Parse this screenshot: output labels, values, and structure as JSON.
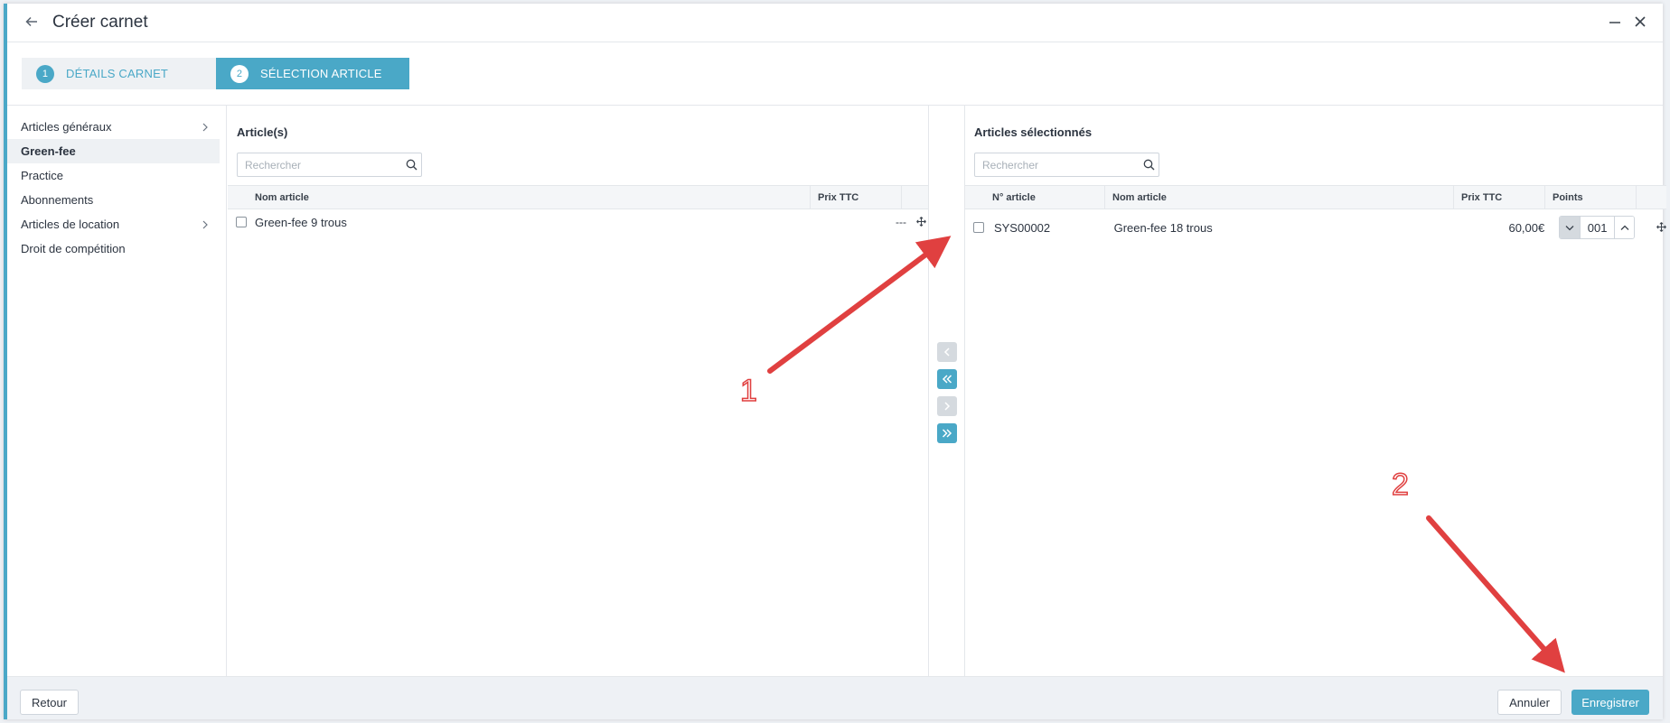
{
  "header": {
    "title": "Créer carnet"
  },
  "steps": [
    {
      "num": "1",
      "label": "DÉTAILS CARNET"
    },
    {
      "num": "2",
      "label": "SÉLECTION ARTICLE"
    }
  ],
  "sidebar": {
    "items": [
      {
        "label": "Articles généraux",
        "has_children": true
      },
      {
        "label": "Green-fee",
        "active": true
      },
      {
        "label": "Practice"
      },
      {
        "label": "Abonnements"
      },
      {
        "label": "Articles de location",
        "has_children": true
      },
      {
        "label": "Droit de compétition"
      }
    ]
  },
  "left_panel": {
    "title": "Article(s)",
    "search_placeholder": "Rechercher",
    "columns": [
      "Nom article",
      "Prix TTC"
    ],
    "rows": [
      {
        "name": "Green-fee 9 trous",
        "price": "---"
      }
    ]
  },
  "right_panel": {
    "title": "Articles sélectionnés",
    "search_placeholder": "Rechercher",
    "columns": [
      "N° article",
      "Nom article",
      "Prix TTC",
      "Points"
    ],
    "rows": [
      {
        "number": "SYS00002",
        "name": "Green-fee 18 trous",
        "price": "60,00€",
        "points": "001"
      }
    ]
  },
  "footer": {
    "back_label": "Retour",
    "cancel_label": "Annuler",
    "save_label": "Enregistrer"
  },
  "annotations": {
    "one": "1",
    "two": "2"
  },
  "colors": {
    "accent": "#4aa8c7",
    "annotation_arrow": "#e04040"
  }
}
